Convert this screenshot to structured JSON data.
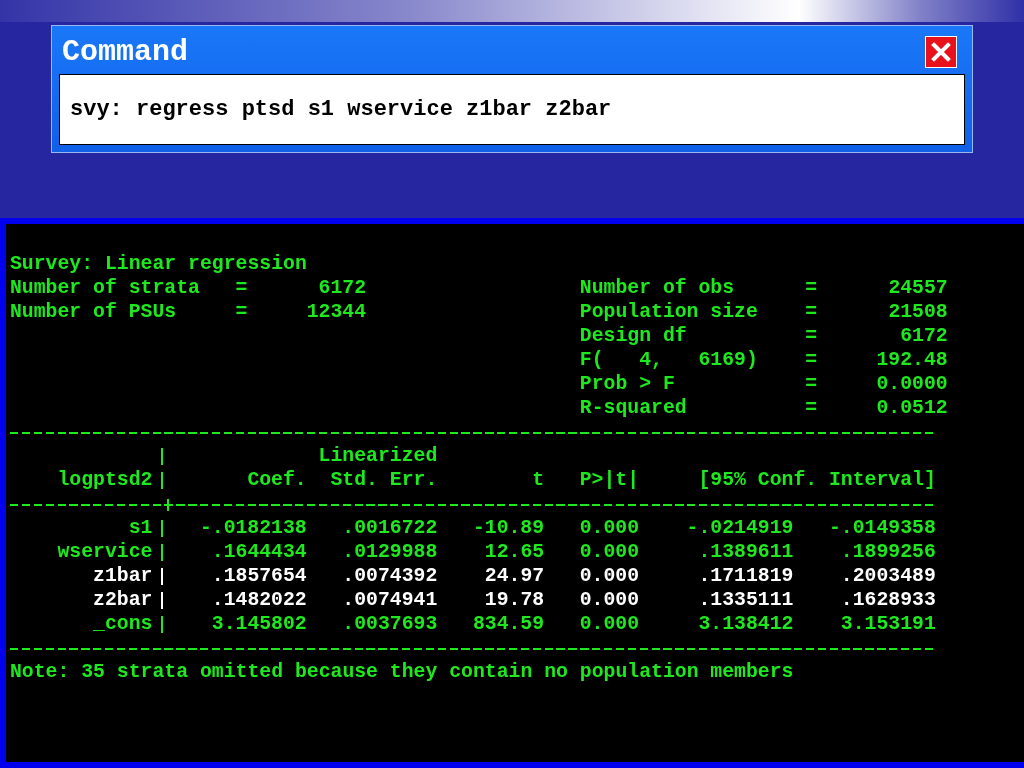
{
  "command_window": {
    "title": "Command",
    "command": "svy: regress ptsd s1 wservice z1bar z2bar"
  },
  "output": {
    "title": "Survey: Linear regression",
    "left_stats": [
      {
        "label": "Number of strata",
        "separator": "=",
        "value": "6172"
      },
      {
        "label": "Number of PSUs",
        "separator": "=",
        "value": "12344"
      }
    ],
    "right_stats": [
      {
        "label": "Number of obs",
        "separator": "=",
        "value": "24557"
      },
      {
        "label": "Population size",
        "separator": "=",
        "value": "21508"
      },
      {
        "label": "Design df",
        "separator": "=",
        "value": "6172"
      },
      {
        "label": "F(   4,   6169)",
        "separator": "=",
        "value": "192.48"
      },
      {
        "label": "Prob > F",
        "separator": "=",
        "value": "0.0000"
      },
      {
        "label": "R-squared",
        "separator": "=",
        "value": "0.0512"
      }
    ],
    "table": {
      "header_top": "Linearized",
      "depvar": "logptsd2",
      "columns": [
        "Coef.",
        "Std. Err.",
        "t",
        "P>|t|",
        "[95% Conf. Interval]"
      ],
      "rows": [
        {
          "name": "s1",
          "values": [
            "-.0182138",
            ".0016722",
            "-10.89",
            "0.000",
            "-.0214919",
            "-.0149358"
          ],
          "highlighted": false
        },
        {
          "name": "wservice",
          "values": [
            ".1644434",
            ".0129988",
            "12.65",
            "0.000",
            ".1389611",
            ".1899256"
          ],
          "highlighted": false
        },
        {
          "name": "z1bar",
          "values": [
            ".1857654",
            ".0074392",
            "24.97",
            "0.000",
            ".1711819",
            ".2003489"
          ],
          "highlighted": true
        },
        {
          "name": "z2bar",
          "values": [
            ".1482022",
            ".0074941",
            "19.78",
            "0.000",
            ".1335111",
            ".1628933"
          ],
          "highlighted": true
        },
        {
          "name": "_cons",
          "values": [
            "3.145802",
            ".0037693",
            "834.59",
            "0.000",
            "3.138412",
            "3.153191"
          ],
          "highlighted": false
        }
      ]
    },
    "note": "Note: 35 strata omitted because they contain no population members"
  }
}
